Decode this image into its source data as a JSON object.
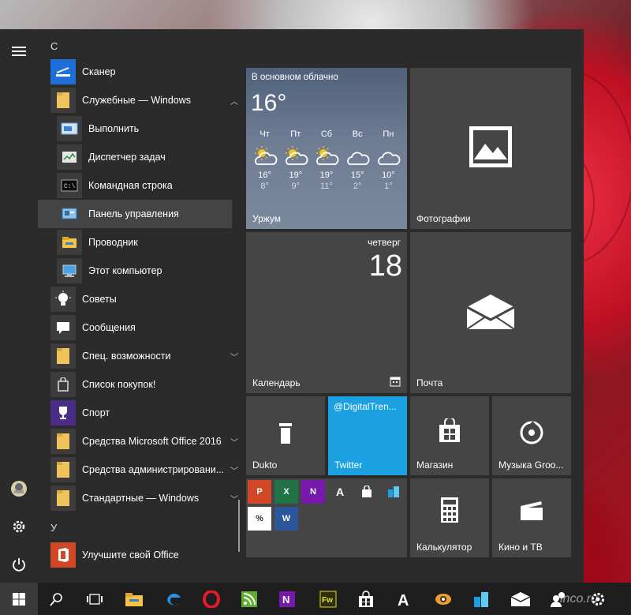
{
  "start_menu": {
    "app_list": {
      "group_c": "С",
      "group_u": "У",
      "items": [
        {
          "label": "Сканер"
        },
        {
          "label": "Служебные — Windows"
        },
        {
          "label": "Выполнить"
        },
        {
          "label": "Диспетчер задач"
        },
        {
          "label": "Командная строка"
        },
        {
          "label": "Панель управления"
        },
        {
          "label": "Проводник"
        },
        {
          "label": "Этот компьютер"
        },
        {
          "label": "Советы"
        },
        {
          "label": "Сообщения"
        },
        {
          "label": "Спец. возможности"
        },
        {
          "label": "Список покупок!"
        },
        {
          "label": "Спорт"
        },
        {
          "label": "Средства Microsoft Office 2016"
        },
        {
          "label": "Средства администрировани..."
        },
        {
          "label": "Стандартные — Windows"
        },
        {
          "label": "Улучшите свой Office"
        }
      ]
    },
    "tiles": {
      "weather": {
        "condition": "В основном облачно",
        "current_temp": "16°",
        "location": "Уржум",
        "days": [
          {
            "day": "Чт",
            "high": "16°",
            "low": "8°"
          },
          {
            "day": "Пт",
            "high": "19°",
            "low": "9°"
          },
          {
            "day": "Сб",
            "high": "19°",
            "low": "11°"
          },
          {
            "day": "Вс",
            "high": "15°",
            "low": "2°"
          },
          {
            "day": "Пн",
            "high": "10°",
            "low": "1°"
          }
        ]
      },
      "photos": {
        "label": "Фотографии"
      },
      "calendar": {
        "weekday": "четверг",
        "date": "18",
        "label": "Календарь"
      },
      "mail": {
        "label": "Почта"
      },
      "dukto": {
        "label": "Dukto"
      },
      "twitter": {
        "handle": "@DigitalTren...",
        "label": "Twitter"
      },
      "store": {
        "label": "Магазин"
      },
      "groove": {
        "label": "Музыка Groo..."
      },
      "calculator": {
        "label": "Калькулятор"
      },
      "movies": {
        "label": "Кино и ТВ"
      },
      "office_mini": [
        "P",
        "X",
        "N",
        "A",
        "bag",
        "buildings",
        "%",
        "W"
      ]
    }
  },
  "taskbar": {
    "watermark": "vinco.ru"
  },
  "colors": {
    "accent_blue": "#1ba1e2",
    "office_red": "#d24726",
    "excel_green": "#217346",
    "onenote_purple": "#7719aa",
    "word_blue": "#2b579a"
  }
}
